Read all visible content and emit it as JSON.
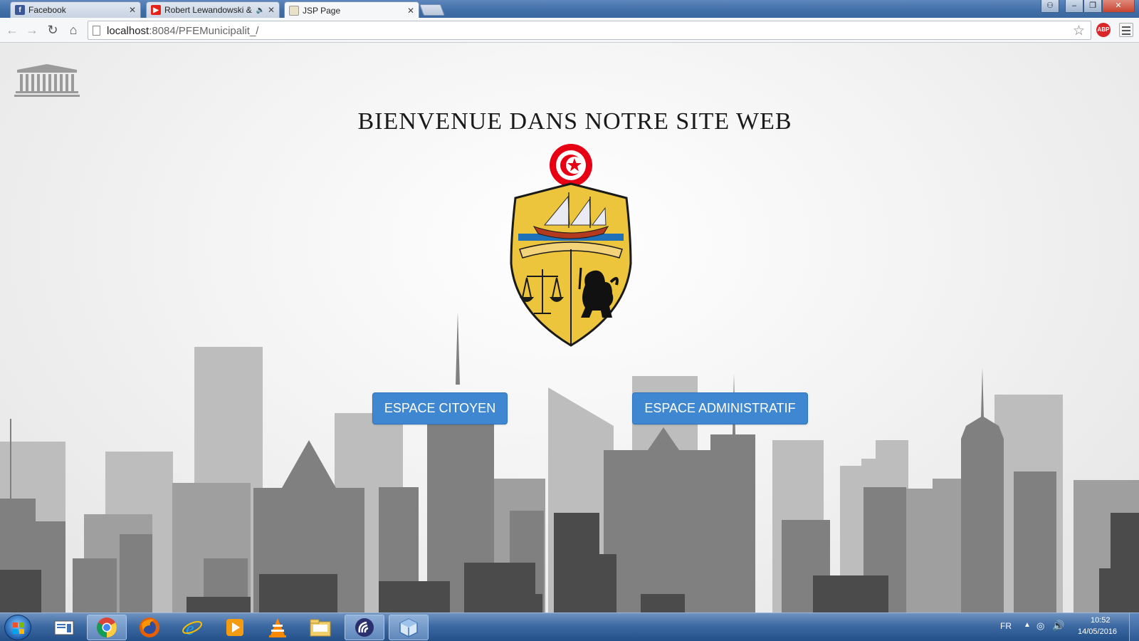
{
  "browser": {
    "tabs": [
      {
        "title": "Facebook",
        "icon": "facebook-icon",
        "active": false
      },
      {
        "title": "Robert Lewandowski &",
        "icon": "youtube-icon",
        "active": false,
        "audio": true
      },
      {
        "title": "JSP Page",
        "icon": "page-icon",
        "active": true
      }
    ],
    "address": {
      "host": "localhost",
      "path": ":8084/PFEMunicipalit_/"
    },
    "extension_badge": "ABP"
  },
  "page": {
    "title": "BIENVENUE DANS NOTRE SITE WEB",
    "buttons": {
      "citoyen": "ESPACE CITOYEN",
      "admin": "ESPACE ADMINISTRATIF"
    }
  },
  "taskbar": {
    "apps": [
      "windows-explorer-icon",
      "chrome-icon",
      "firefox-icon",
      "ie-icon",
      "media-player-icon",
      "vlc-icon",
      "file-manager-icon",
      "app-icon",
      "virtualbox-icon"
    ],
    "language": "FR",
    "time": "10:52",
    "date": "14/05/2016"
  },
  "colors": {
    "button": "#3f87d0",
    "emblem_gold": "#e8c33b",
    "flag_red": "#e70013"
  }
}
